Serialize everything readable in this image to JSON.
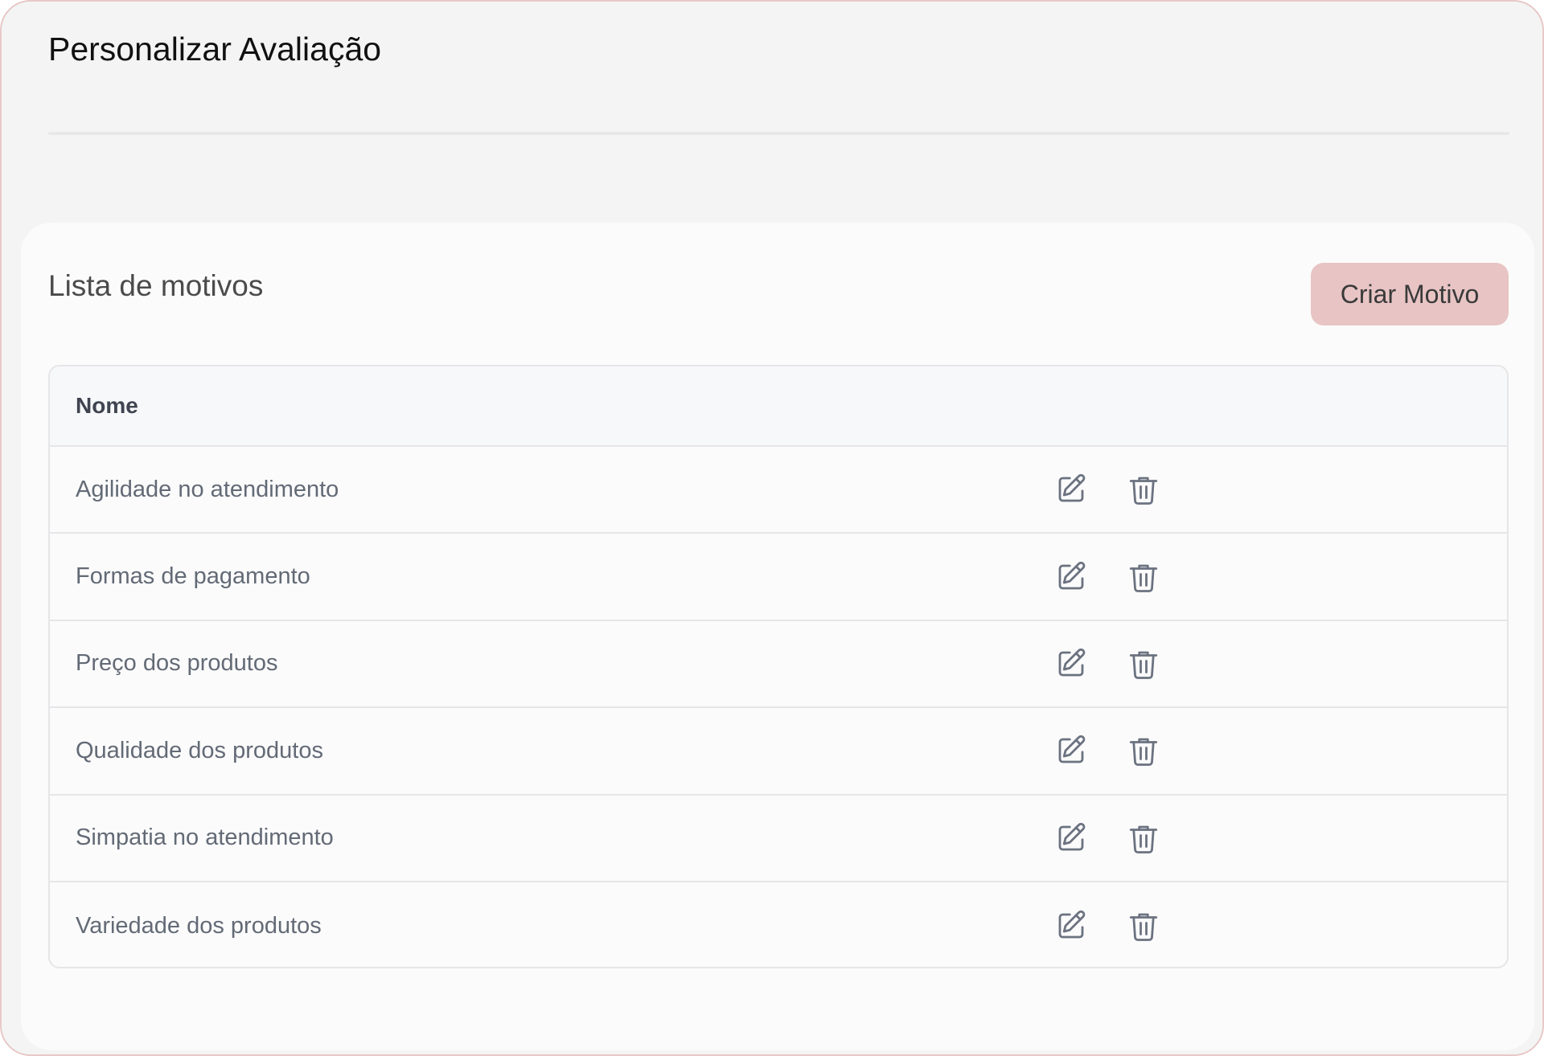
{
  "page": {
    "title": "Personalizar Avaliação"
  },
  "card": {
    "title": "Lista de motivos",
    "create_button_label": "Criar Motivo"
  },
  "table": {
    "header": "Nome",
    "rows": [
      {
        "name": "Agilidade no atendimento",
        "edit_icon": "edit-icon",
        "delete_icon": "trash-icon"
      },
      {
        "name": "Formas de pagamento",
        "edit_icon": "edit-icon",
        "delete_icon": "trash-icon"
      },
      {
        "name": "Preço dos produtos",
        "edit_icon": "edit-icon",
        "delete_icon": "trash-icon"
      },
      {
        "name": "Qualidade dos produtos",
        "edit_icon": "edit-icon",
        "delete_icon": "trash-icon"
      },
      {
        "name": "Simpatia no atendimento",
        "edit_icon": "edit-icon",
        "delete_icon": "trash-icon"
      },
      {
        "name": "Variedade dos produtos",
        "edit_icon": "edit-icon",
        "delete_icon": "trash-icon"
      }
    ]
  },
  "colors": {
    "accent_button": "#e8c4c4",
    "frame_border": "#e8c8c8",
    "background": "#f4f4f4",
    "card": "#fbfbfb",
    "icon": "#6b7280"
  }
}
